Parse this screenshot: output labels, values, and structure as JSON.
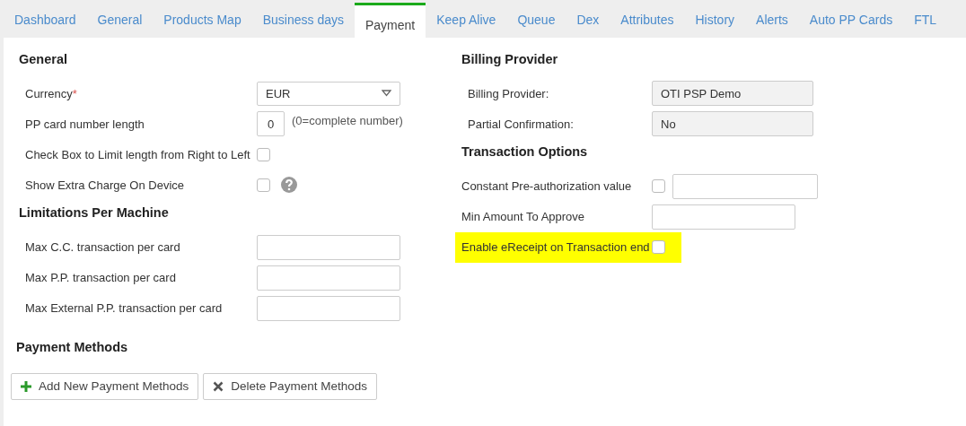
{
  "tabs": [
    {
      "label": "Dashboard",
      "selected": false
    },
    {
      "label": "General",
      "selected": false
    },
    {
      "label": "Products Map",
      "selected": false
    },
    {
      "label": "Business days",
      "selected": false
    },
    {
      "label": "Payment",
      "selected": true
    },
    {
      "label": "Keep Alive",
      "selected": false
    },
    {
      "label": "Queue",
      "selected": false
    },
    {
      "label": "Dex",
      "selected": false
    },
    {
      "label": "Attributes",
      "selected": false
    },
    {
      "label": "History",
      "selected": false
    },
    {
      "label": "Alerts",
      "selected": false
    },
    {
      "label": "Auto PP Cards",
      "selected": false
    },
    {
      "label": "FTL",
      "selected": false
    }
  ],
  "left_sections": [
    {
      "title": "General",
      "fields": [
        {
          "kind": "select",
          "label": "Currency",
          "required_mark": "*",
          "value": "EUR"
        },
        {
          "kind": "number",
          "label": "PP card number length",
          "value": "0",
          "note": "(0=complete number)"
        },
        {
          "kind": "checkbox",
          "label": "Check Box to Limit length from Right to Left",
          "checked": false,
          "help": false
        },
        {
          "kind": "checkbox",
          "label": "Show Extra Charge On Device",
          "checked": false,
          "help": true
        }
      ]
    },
    {
      "title": "Limitations Per Machine",
      "fields": [
        {
          "kind": "text",
          "label": "Max C.C. transaction per card"
        },
        {
          "kind": "text",
          "label": "Max P.P. transaction per card"
        },
        {
          "kind": "text",
          "label": "Max External P.P. transaction per card"
        }
      ]
    }
  ],
  "right_sections": [
    {
      "title": "Billing Provider",
      "fields": [
        {
          "kind": "readonly",
          "label": "Billing Provider:",
          "value": "OTI PSP Demo"
        },
        {
          "kind": "readonly",
          "label": "Partial Confirmation:",
          "value": "No"
        }
      ]
    },
    {
      "title": "Transaction Options",
      "fields": [
        {
          "kind": "checkbox_text",
          "label": "Constant Pre-authorization value",
          "checked": false,
          "highlighted": false
        },
        {
          "kind": "text",
          "label": "Min Amount To Approve",
          "highlighted": false
        },
        {
          "kind": "checkbox",
          "label": "Enable eReceipt on Transaction end",
          "checked": false,
          "highlighted": true
        }
      ]
    }
  ],
  "payment_methods": {
    "title": "Payment Methods",
    "buttons": [
      {
        "kind": "add",
        "label": "Add New Payment Methods"
      },
      {
        "kind": "delete",
        "label": "Delete Payment Methods"
      }
    ]
  }
}
